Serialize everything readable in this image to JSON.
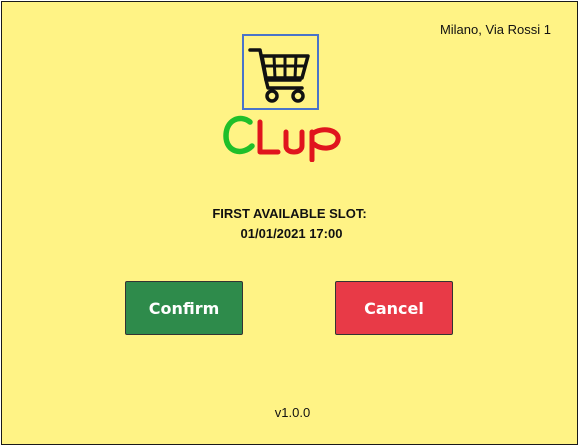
{
  "header": {
    "address": "Milano, Via Rossi 1"
  },
  "logo": {
    "icon": "shopping-cart-icon",
    "brand_text": "CLup",
    "brand_colors": {
      "c": "#1fbf2a",
      "rest": "#e0141d"
    },
    "frame_color": "#4a74c9"
  },
  "slot": {
    "title": "FIRST AVAILABLE SLOT:",
    "datetime": "01/01/2021 17:00"
  },
  "actions": {
    "confirm_label": "Confirm",
    "cancel_label": "Cancel",
    "confirm_color": "#2e8b4b",
    "cancel_color": "#e83a47"
  },
  "footer": {
    "version": "v1.0.0"
  },
  "theme": {
    "background": "#fff385"
  }
}
